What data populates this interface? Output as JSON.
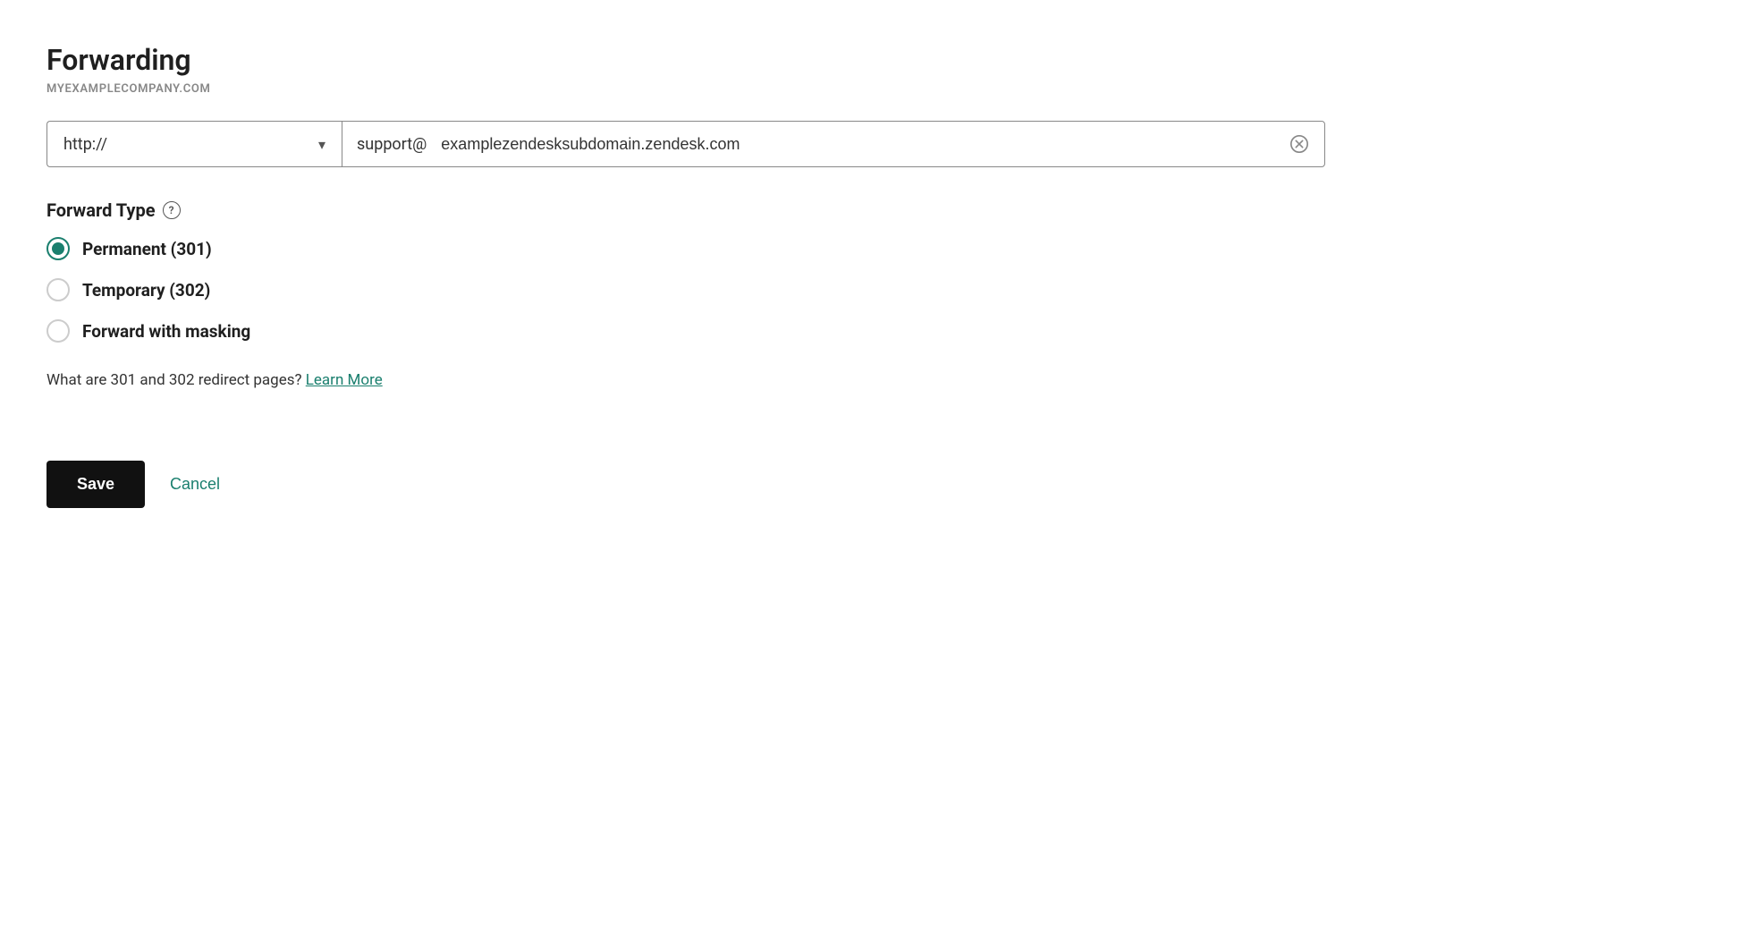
{
  "page": {
    "title": "Forwarding",
    "domain": "MYEXAMPLECOMPANY.COM"
  },
  "url_row": {
    "protocol_value": "http://",
    "url_prefix": "support@",
    "url_placeholder": "examplezendesksubdomain.zendesk.com",
    "url_value": "examplezendesksubdomain.zendesk.com"
  },
  "forward_type": {
    "label": "Forward Type",
    "help_icon_label": "?",
    "options": [
      {
        "id": "permanent",
        "label": "Permanent (301)",
        "selected": true
      },
      {
        "id": "temporary",
        "label": "Temporary (302)",
        "selected": false
      },
      {
        "id": "masking",
        "label": "Forward with masking",
        "selected": false
      }
    ]
  },
  "info": {
    "text": "What are 301 and 302 redirect pages?",
    "link_label": "Learn More"
  },
  "actions": {
    "save_label": "Save",
    "cancel_label": "Cancel"
  },
  "icons": {
    "chevron": "▾",
    "close": "✕",
    "help": "?"
  }
}
